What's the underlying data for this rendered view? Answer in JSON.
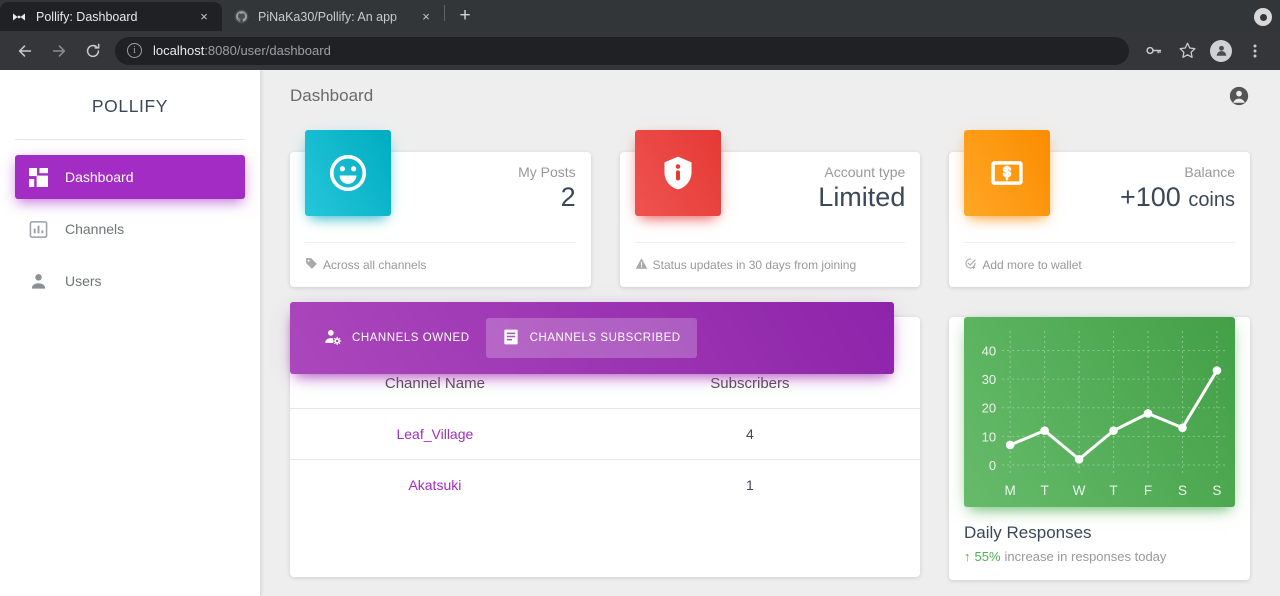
{
  "browser": {
    "tabs": [
      {
        "title": "Pollify: Dashboard",
        "favicon": "pollify-bowtie-icon",
        "active": true
      },
      {
        "title": "PiNaKa30/Pollify: An app ",
        "favicon": "github-icon",
        "active": false
      }
    ],
    "new_tab_label": "+",
    "close_label": "×",
    "toolbar": {
      "back": "back-arrow",
      "forward": "forward-arrow",
      "reload": "reload-icon",
      "url_host": "localhost",
      "url_rest": ":8080/user/dashboard",
      "info_glyph": "i",
      "key_icon": "key-icon",
      "star_icon": "star-icon",
      "profile_icon": "profile-avatar-icon",
      "menu_icon": "three-dot-menu-icon"
    }
  },
  "sidebar": {
    "brand": "POLLIFY",
    "items": [
      {
        "label": "Dashboard",
        "icon": "dashboard-grid-icon",
        "active": true
      },
      {
        "label": "Channels",
        "icon": "bar-chart-icon",
        "active": false
      },
      {
        "label": "Users",
        "icon": "person-icon",
        "active": false
      }
    ],
    "accent": "#a32cc4"
  },
  "topbar": {
    "title": "Dashboard",
    "account_icon": "account-circle-icon"
  },
  "stats": [
    {
      "icon": "smiley-face-icon",
      "color": "#00acc1",
      "label": "My Posts",
      "value": "2",
      "unit": "",
      "foot_icon": "tag-icon",
      "foot": "Across all channels"
    },
    {
      "icon": "shield-info-icon",
      "color": "#e53935",
      "label": "Account type",
      "value": "Limited",
      "unit": "",
      "foot_icon": "warning-triangle-icon",
      "foot": "Status updates in 30 days from joining"
    },
    {
      "icon": "money-bill-icon",
      "color": "#fb8c00",
      "label": "Balance",
      "value": "+100",
      "unit": "coins",
      "foot_icon": "add-check-icon",
      "foot": "Add more to wallet"
    }
  ],
  "channels_panel": {
    "tabs": [
      {
        "label": "CHANNELS OWNED",
        "icon": "person-gear-icon",
        "selected": false
      },
      {
        "label": "CHANNELS SUBSCRIBED",
        "icon": "list-document-icon",
        "selected": true
      }
    ],
    "table": {
      "headers": [
        "Channel Name",
        "Subscribers"
      ],
      "rows": [
        [
          "Leaf_Village",
          "4"
        ],
        [
          "Akatsuki",
          "1"
        ]
      ]
    }
  },
  "chart_panel": {
    "title": "Daily Responses",
    "trend_arrow": "↑",
    "trend_pct": "55%",
    "trend_text": "increase in responses today",
    "trend_color": "#4caf50"
  },
  "chart_data": {
    "type": "line",
    "title": "Daily Responses",
    "categories": [
      "M",
      "T",
      "W",
      "T",
      "F",
      "S",
      "S"
    ],
    "values": [
      7,
      12,
      2,
      12,
      18,
      13,
      33
    ],
    "xlabel": "",
    "ylabel": "",
    "yticks": [
      0,
      10,
      20,
      30,
      40
    ],
    "ylim": [
      0,
      44
    ],
    "grid": true,
    "legend": false,
    "line_color": "#ffffff",
    "background": "#5cb860"
  }
}
